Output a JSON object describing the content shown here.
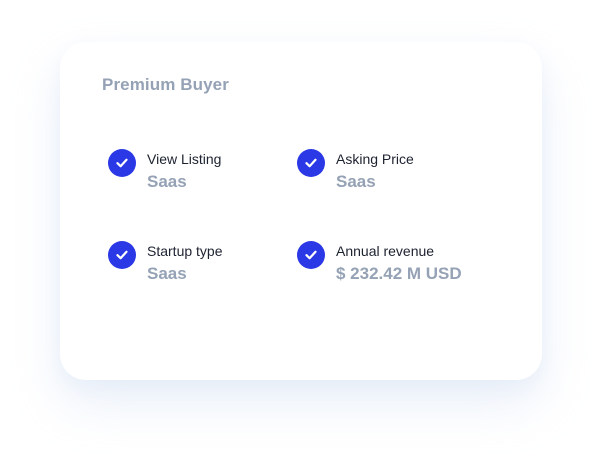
{
  "card": {
    "title": "Premium Buyer"
  },
  "items": [
    {
      "label": "View Listing",
      "value": "Saas",
      "icon": "check-circle-icon"
    },
    {
      "label": "Asking Price",
      "value": "Saas",
      "icon": "check-circle-icon"
    },
    {
      "label": "Startup type",
      "value": "Saas",
      "icon": "check-circle-icon"
    },
    {
      "label": "Annual revenue",
      "value": "$ 232.42 M USD",
      "icon": "check-circle-icon"
    }
  ],
  "colors": {
    "accent": "#2b38e6",
    "muted_text": "#95a2b5",
    "label_text": "#1d2230",
    "card_background": "#ffffff"
  }
}
